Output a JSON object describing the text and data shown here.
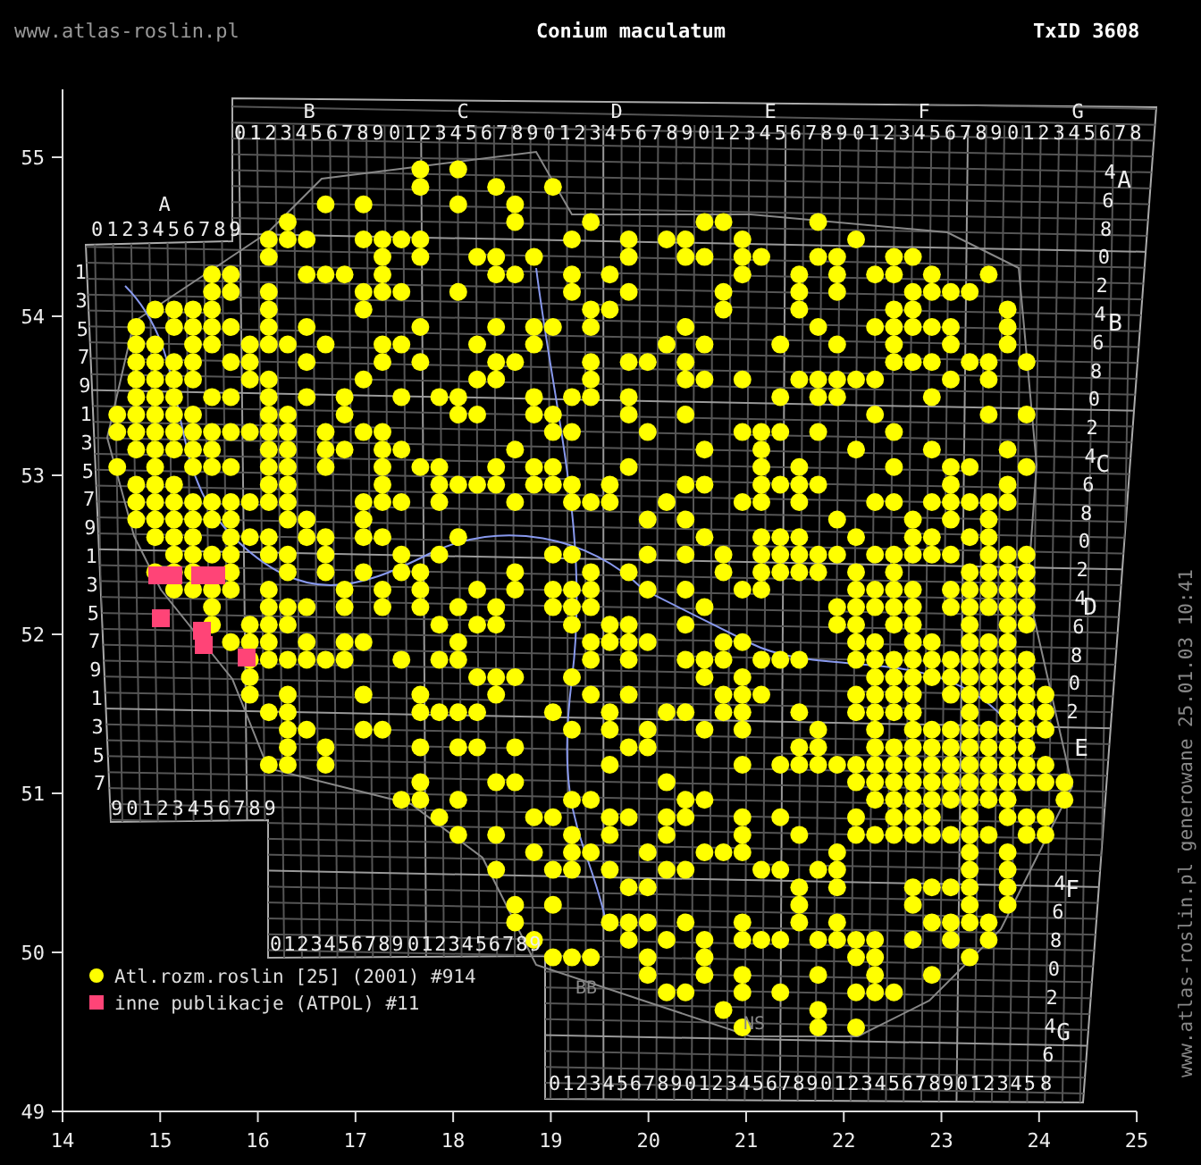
{
  "header": {
    "site": "www.atlas-roslin.pl",
    "title": "Conium maculatum",
    "taxon_id": "TxID 3608"
  },
  "axes": {
    "x_ticks": [
      "14",
      "15",
      "16",
      "17",
      "18",
      "19",
      "20",
      "21",
      "22",
      "23",
      "24",
      "25"
    ],
    "y_ticks": [
      "55",
      "54",
      "53",
      "52",
      "51",
      "50",
      "49"
    ]
  },
  "grid": {
    "top_letters": [
      "B",
      "C",
      "D",
      "E",
      "F",
      "G"
    ],
    "top_digits": [
      "0123456789",
      "0123456789",
      "0123456789",
      "0123456789",
      "0123456789",
      "012345678"
    ],
    "left_letter": "A",
    "left_top_digits": "0123456789",
    "left_digits": [
      "1",
      "3",
      "5",
      "7",
      "9",
      "1",
      "3",
      "5",
      "7",
      "9",
      "1",
      "3",
      "5",
      "7",
      "9",
      "1",
      "3",
      "5",
      "7"
    ],
    "left_bottom_digits": "90123456789",
    "right_letters": [
      "A",
      "B",
      "C",
      "D",
      "E",
      "F",
      "G"
    ],
    "right_digits_upper": [
      "4",
      "6",
      "8",
      "0",
      "2",
      "4",
      "6",
      "8",
      "0",
      "2",
      "4",
      "6",
      "8",
      "0",
      "2",
      "4",
      "6",
      "8",
      "0",
      "2"
    ],
    "right_digits_lower": [
      "4",
      "6",
      "8",
      "0",
      "2",
      "4",
      "6",
      "8"
    ],
    "bottom_left_digits": [
      "0123456789",
      "0123456789"
    ],
    "bottom_right_digits": [
      "0123456789",
      "0123456789",
      "0123456789",
      "012345"
    ],
    "region_labels": [
      "BB",
      "NS"
    ]
  },
  "legend": [
    {
      "kind": "circle",
      "label": "Atl.rozm.roslin [25] (2001) #914",
      "color": "#ffff00"
    },
    {
      "kind": "square",
      "label": "inne publikacje (ATPOL) #11",
      "color": "#ff4477"
    }
  ],
  "footer_vertical": "www.atlas-roslin.pl generowane 25.01.03 10:41"
}
